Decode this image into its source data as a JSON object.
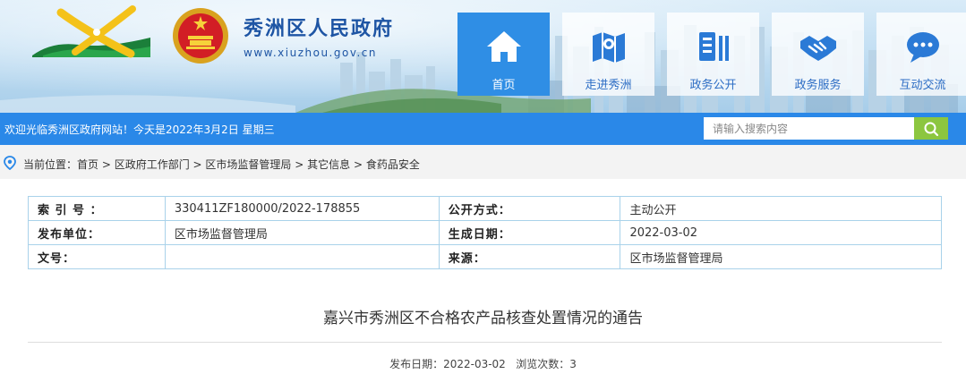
{
  "header": {
    "site_title": "秀洲区人民政府",
    "site_domain": "www.xiuzhou.gov.cn"
  },
  "nav": {
    "items": [
      {
        "label": "首页",
        "icon": "home-icon",
        "active": true
      },
      {
        "label": "走进秀洲",
        "icon": "map-icon",
        "active": false
      },
      {
        "label": "政务公开",
        "icon": "document-icon",
        "active": false
      },
      {
        "label": "政务服务",
        "icon": "handshake-icon",
        "active": false
      },
      {
        "label": "互动交流",
        "icon": "chat-icon",
        "active": false
      }
    ]
  },
  "topbar": {
    "welcome": "欢迎光临秀洲区政府网站！今天是2022年3月2日 星期三",
    "search_placeholder": "请输入搜索内容"
  },
  "breadcrumb": {
    "prefix": "当前位置：",
    "items": [
      "首页",
      "区政府工作部门",
      "区市场监督管理局",
      "其它信息",
      "食药品安全"
    ],
    "separator": " > "
  },
  "meta": {
    "rows": [
      {
        "k1": "索 引 号 ：",
        "v1": "330411ZF180000/2022-178855",
        "k2": "公开方式：",
        "v2": "主动公开"
      },
      {
        "k1": "发布单位：",
        "v1": "区市场监督管理局",
        "k2": "生成日期：",
        "v2": "2022-03-02"
      },
      {
        "k1": "文号：",
        "v1": "",
        "k2": "来源：",
        "v2": "区市场监督管理局"
      }
    ]
  },
  "article": {
    "title": "嘉兴市秀洲区不合格农产品核查处置情况的通告",
    "pub_label": "发布日期：",
    "pub_date": "2022-03-02",
    "views_label": "浏览次数：",
    "views": "3"
  },
  "colors": {
    "primary_blue": "#2a88e8",
    "nav_active": "#2f8ee5",
    "search_button": "#8cc63f",
    "title_blue": "#1e55a4",
    "table_border": "#a9d2ea"
  }
}
